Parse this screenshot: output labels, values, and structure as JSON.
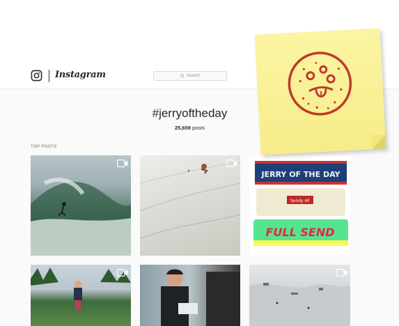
{
  "header": {
    "brand": "Instagram",
    "search_placeholder": "Search"
  },
  "tag": {
    "title": "#jerryoftheday",
    "post_count": "25,659",
    "post_count_suffix": "posts"
  },
  "section": {
    "top_posts_label": "TOP POSTS"
  },
  "posts": [
    {
      "kind": "video",
      "subject": "surfer on wave"
    },
    {
      "kind": "video",
      "subject": "skier on snow slope"
    },
    {
      "kind": "image",
      "subject": "headbands",
      "texts": [
        "JERRY OF THE DAY",
        "Sendy AF",
        "FULL SEND"
      ]
    },
    {
      "kind": "video",
      "subject": "person outdoors"
    },
    {
      "kind": "image",
      "subject": "man at computer"
    },
    {
      "kind": "video",
      "subject": "snow terrain park"
    }
  ],
  "colors": {
    "background": "#fafafa",
    "sticky_note": "#fbf5a3",
    "drawing": "#c0392b"
  }
}
